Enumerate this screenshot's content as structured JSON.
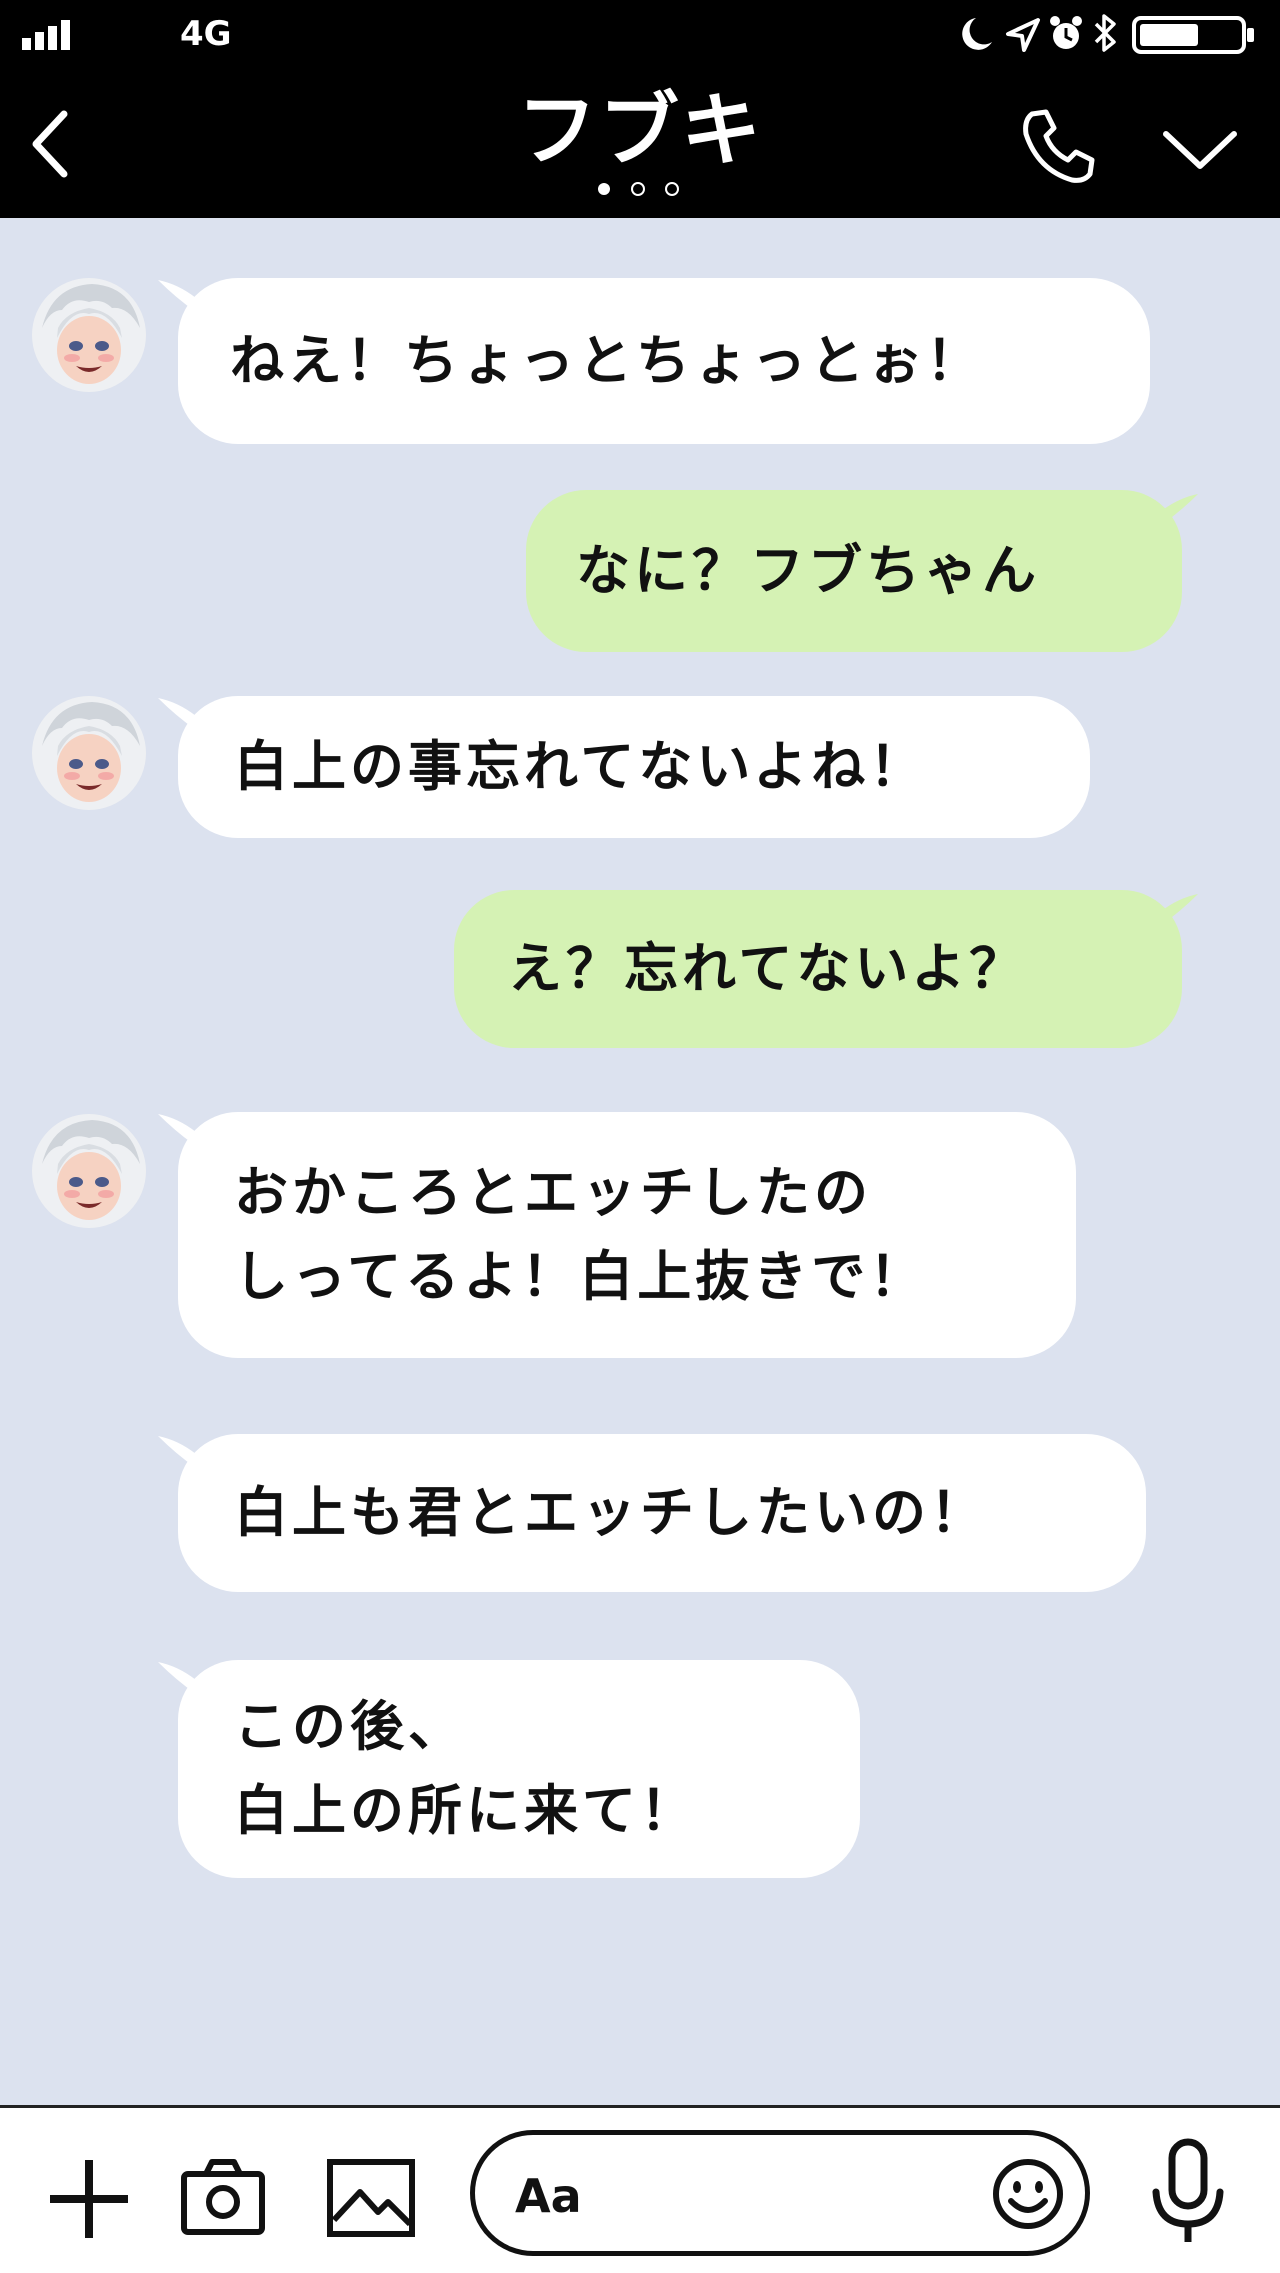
{
  "status_bar": {
    "network": "4G"
  },
  "header": {
    "title": "フブキ",
    "page_indicator": {
      "count": 3,
      "active": 1
    }
  },
  "messages": [
    {
      "side": "in",
      "show_avatar": true,
      "text": "ねえ！ちょっとちょっとぉ！"
    },
    {
      "side": "out",
      "show_avatar": false,
      "text": "なに？フブちゃん"
    },
    {
      "side": "in",
      "show_avatar": true,
      "text": "白上の事忘れてないよね！"
    },
    {
      "side": "out",
      "show_avatar": false,
      "text": "え？忘れてないよ？"
    },
    {
      "side": "in",
      "show_avatar": true,
      "text": "おかころとエッチしたの\nしってるよ！白上抜きで！"
    },
    {
      "side": "in",
      "show_avatar": false,
      "text": "白上も君とエッチしたいの！"
    },
    {
      "side": "in",
      "show_avatar": false,
      "text": "この後、\n白上の所に来て！"
    }
  ],
  "footer": {
    "input_placeholder": "Aa"
  },
  "colors": {
    "header_bg": "#000000",
    "chat_bg": "#dce2ef",
    "incoming_bubble": "#ffffff",
    "outgoing_bubble": "#d5f2b4"
  },
  "icons": {
    "back": "chevron-left-icon",
    "call": "phone-icon",
    "menu": "chevron-down-icon",
    "plus": "plus-icon",
    "camera": "camera-icon",
    "image": "image-icon",
    "emoji": "smiley-icon",
    "mic": "microphone-icon"
  }
}
